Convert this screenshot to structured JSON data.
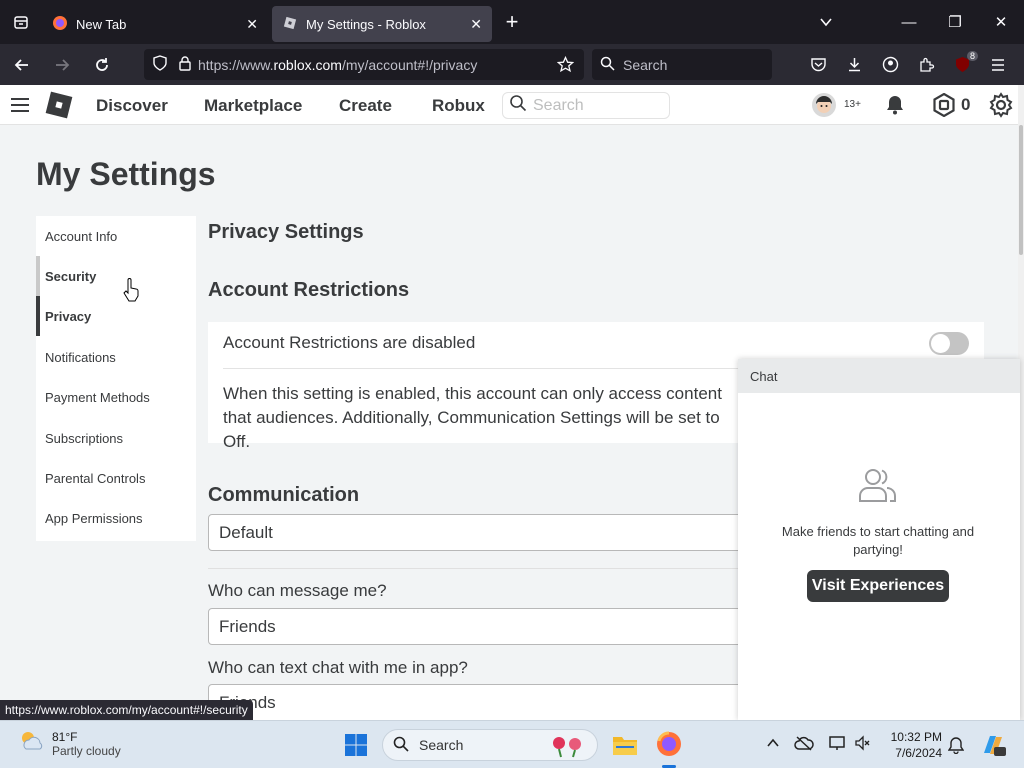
{
  "browser": {
    "tabs": [
      {
        "title": "New Tab",
        "active": false
      },
      {
        "title": "My Settings - Roblox",
        "active": true
      }
    ],
    "url_prefix": "https://www.",
    "url_domain": "roblox.com",
    "url_suffix": "/my/account#!/privacy",
    "search_placeholder": "Search",
    "extension_badge": "8",
    "status_link": "https://www.roblox.com/my/account#!/security"
  },
  "roblox_header": {
    "nav": [
      "Discover",
      "Marketplace",
      "Create",
      "Robux"
    ],
    "search_placeholder": "Search",
    "age_badge": "13+",
    "robux_count": "0"
  },
  "page": {
    "title": "My Settings",
    "side_menu": [
      "Account Info",
      "Security",
      "Privacy",
      "Notifications",
      "Payment Methods",
      "Subscriptions",
      "Parental Controls",
      "App Permissions"
    ],
    "active_item": "Privacy",
    "hover_item": "Security",
    "privacy_heading": "Privacy Settings",
    "restrictions_heading": "Account Restrictions",
    "restrictions_status": "Account Restrictions are disabled",
    "restrictions_enabled": false,
    "restrictions_desc": "When this setting is enabled, this account can only access content that audiences. Additionally, Communication Settings will be set to Off.",
    "communication_heading": "Communication",
    "communication_value": "Default",
    "message_label": "Who can message me?",
    "message_value": "Friends",
    "text_chat_label": "Who can text chat with me in app?",
    "text_chat_value": "Friends"
  },
  "chat": {
    "title": "Chat",
    "empty_text": "Make friends to start chatting and partying!",
    "button": "Visit Experiences"
  },
  "taskbar": {
    "temp": "81°F",
    "condition": "Partly cloudy",
    "search_label": "Search",
    "time": "10:32 PM",
    "date": "7/6/2024"
  }
}
